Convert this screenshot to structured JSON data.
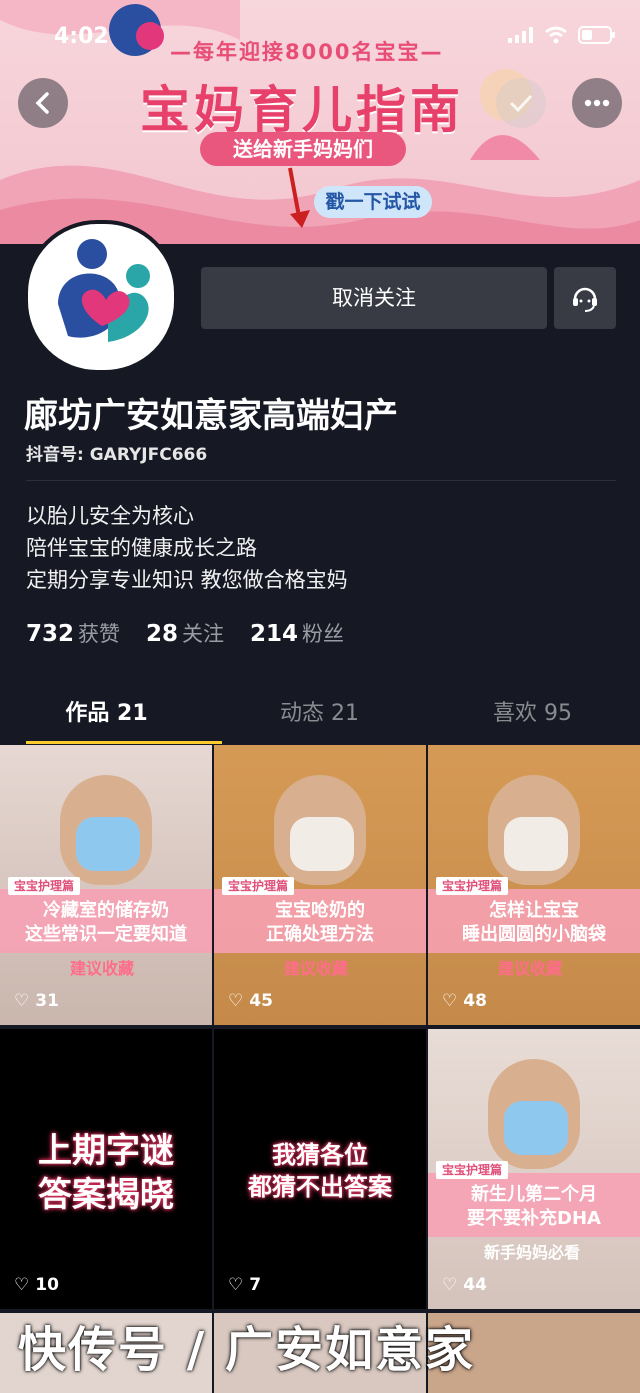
{
  "status_bar": {
    "time": "4:02"
  },
  "banner": {
    "tagline": "—每年迎接8000名宝宝—",
    "title": "宝妈育儿指南",
    "pill": "送给新手妈妈们",
    "poke": "戳一下试试"
  },
  "profile": {
    "unfollow_label": "取消关注",
    "name": "廊坊广安如意家高端妇产",
    "douyin_id": "抖音号: GARYJFC666",
    "bio": [
      "以胎儿安全为核心",
      "陪伴宝宝的健康成长之路",
      "定期分享专业知识  教您做合格宝妈"
    ],
    "stats": [
      {
        "value": "732",
        "label": "获赞"
      },
      {
        "value": "28",
        "label": "关注"
      },
      {
        "value": "214",
        "label": "粉丝"
      }
    ]
  },
  "tabs": [
    {
      "label": "作品 21"
    },
    {
      "label": "动态 21"
    },
    {
      "label": "喜欢 95"
    }
  ],
  "videos": [
    {
      "tag": "宝宝护理篇",
      "caption1": "冷藏室的储存奶",
      "caption2": "这些常识一定要知道",
      "sub": "建议收藏",
      "likes": "31"
    },
    {
      "tag": "宝宝护理篇",
      "caption1": "宝宝呛奶的",
      "caption2": "正确处理方法",
      "sub": "建议收藏",
      "likes": "45"
    },
    {
      "tag": "宝宝护理篇",
      "caption1": "怎样让宝宝",
      "caption2": "睡出圆圆的小脑袋",
      "sub": "建议收藏",
      "likes": "48"
    },
    {
      "big1": "上期字谜",
      "big2": "答案揭晓",
      "likes": "10"
    },
    {
      "big1": "我猜各位",
      "big2": "都猜不出答案",
      "likes": "7"
    },
    {
      "tag": "宝宝护理篇",
      "caption1": "新生儿第二个月",
      "caption2": "要不要补充DHA",
      "sub": "新手妈妈必看",
      "likes": "44"
    }
  ],
  "watermark": "快传号 / 广安如意家"
}
